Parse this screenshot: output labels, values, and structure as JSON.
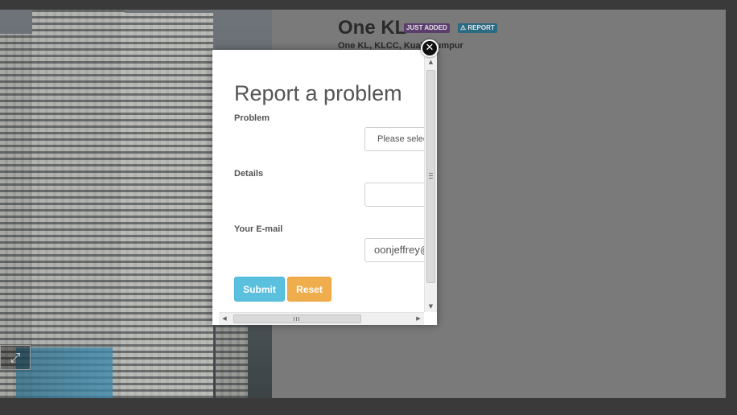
{
  "listing": {
    "title": "One KL",
    "badge_new": "JUST ADDED",
    "badge_report": "⚠ REPORT",
    "address": "One KL, KLCC, Kuala Lumpur"
  },
  "photo": {
    "expand_icon": "expand-icon",
    "expand_glyph": "⤢"
  },
  "modal": {
    "title": "Report a problem",
    "problem_label": "Problem",
    "problem_placeholder": "Please select",
    "details_label": "Details",
    "details_value": "",
    "email_label": "Your E-mail",
    "email_value": "oonjeffrey@",
    "submit_label": "Submit",
    "reset_label": "Reset",
    "close_glyph": "✕"
  },
  "colors": {
    "submit": "#5bc0de",
    "reset": "#f0ad4e",
    "overlay": "#3a3a3a"
  }
}
